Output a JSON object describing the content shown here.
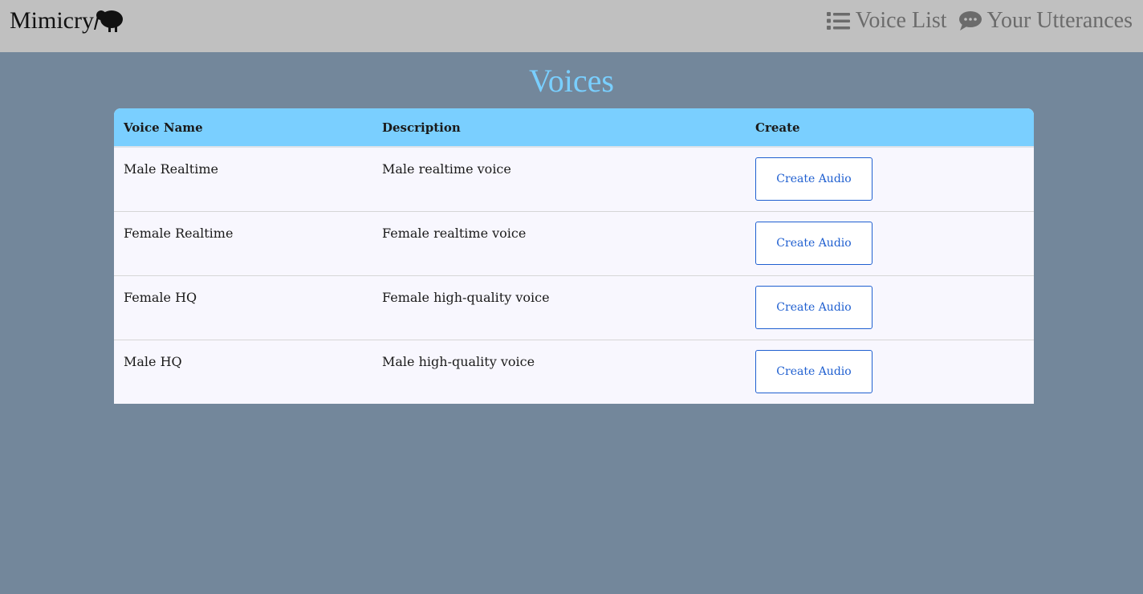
{
  "header": {
    "brand": "Mimicry",
    "brand_icon": "kiwi-bird-icon",
    "nav": [
      {
        "label": "Voice List",
        "icon": "list-icon"
      },
      {
        "label": "Your Utterances",
        "icon": "speech-bubble-icon"
      }
    ]
  },
  "page": {
    "title": "Voices",
    "title_color": "#79cfff",
    "background": "#73879b"
  },
  "table": {
    "columns": [
      "Voice Name",
      "Description",
      "Create"
    ],
    "header_color": "#7acfff",
    "rows": [
      {
        "name": "Male Realtime",
        "description": "Male realtime voice",
        "action": "Create Audio"
      },
      {
        "name": "Female Realtime",
        "description": "Female realtime voice",
        "action": "Create Audio"
      },
      {
        "name": "Female HQ",
        "description": "Female high-quality voice",
        "action": "Create Audio"
      },
      {
        "name": "Male HQ",
        "description": "Male high-quality voice",
        "action": "Create Audio"
      }
    ]
  }
}
